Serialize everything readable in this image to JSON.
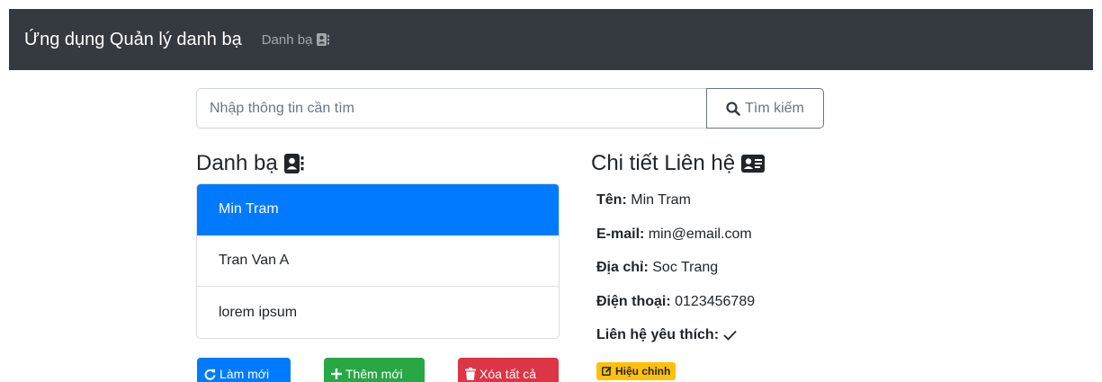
{
  "navbar": {
    "brand": "Ứng dụng Quản lý danh bạ",
    "link": "Danh bạ"
  },
  "search": {
    "placeholder": "Nhập thông tin cần tìm",
    "button_label": "Tìm kiếm"
  },
  "contacts": {
    "heading": "Danh bạ",
    "items": [
      {
        "name": "Min Tram",
        "selected": true
      },
      {
        "name": "Tran Van A",
        "selected": false
      },
      {
        "name": "lorem ipsum",
        "selected": false
      }
    ],
    "buttons": {
      "refresh": "Làm mới",
      "add": "Thêm mới",
      "delete_all": "Xóa tất cả"
    }
  },
  "details": {
    "heading": "Chi tiết Liên hệ",
    "name_label": "Tên:",
    "name_value": "Min Tram",
    "email_label": "E-mail:",
    "email_value": "min@email.com",
    "address_label": "Địa chỉ:",
    "address_value": "Soc Trang",
    "phone_label": "Điện thoại:",
    "phone_value": "0123456789",
    "favorite_label": "Liên hệ yêu thích:",
    "favorite_icon": "check-icon",
    "edit_label": "Hiệu chỉnh"
  },
  "colors": {
    "navbar": "#343a40",
    "primary": "#007bff",
    "success": "#28a745",
    "danger": "#dc3545",
    "warning": "#ffc107"
  }
}
